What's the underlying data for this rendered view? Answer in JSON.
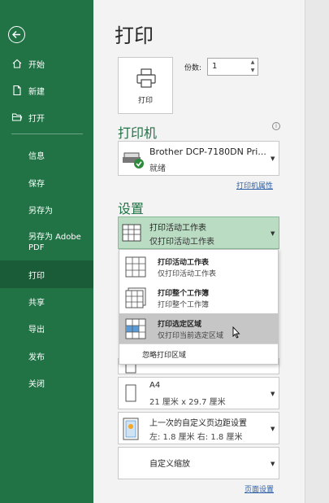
{
  "sidebar": {
    "items": [
      {
        "label": "开始",
        "icon": "home-icon"
      },
      {
        "label": "新建",
        "icon": "new-file-icon"
      },
      {
        "label": "打开",
        "icon": "open-folder-icon"
      },
      {
        "label": "信息"
      },
      {
        "label": "保存"
      },
      {
        "label": "另存为"
      },
      {
        "label": "另存为 Adobe PDF"
      },
      {
        "label": "打印",
        "active": true
      },
      {
        "label": "共享"
      },
      {
        "label": "导出"
      },
      {
        "label": "发布"
      },
      {
        "label": "关闭"
      }
    ]
  },
  "main": {
    "title": "打印",
    "print_button_label": "打印",
    "copies_label": "份数:",
    "copies_value": "1",
    "printer_heading": "打印机",
    "printer_name": "Brother DCP-7180DN Pri...",
    "printer_status": "就绪",
    "printer_properties_link": "打印机属性",
    "settings_heading": "设置",
    "active_setting": {
      "title": "打印活动工作表",
      "subtitle": "仅打印活动工作表"
    },
    "dropdown_options": [
      {
        "title": "打印活动工作表",
        "subtitle": "仅打印活动工作表"
      },
      {
        "title": "打印整个工作簿",
        "subtitle": "打印整个工作簿"
      },
      {
        "title": "打印选定区域",
        "subtitle": "仅打印当前选定区域",
        "selected": true
      }
    ],
    "ignore_print_area": "忽略打印区域",
    "paper_size": {
      "title": "A4",
      "subtitle": "21 厘米 x 29.7 厘米"
    },
    "margins": {
      "title": "上一次的自定义页边距设置",
      "subtitle": "左:  1.8 厘米    右:  1.8 厘米"
    },
    "scaling": {
      "title": "自定义缩放"
    },
    "page_setup_link": "页面设置"
  },
  "colors": {
    "sidebar_bg": "#217346",
    "sidebar_active": "#1a5c37",
    "accent_green": "#217346",
    "link_blue": "#2a5fa8",
    "active_setting_bg": "#b9dcc2"
  }
}
